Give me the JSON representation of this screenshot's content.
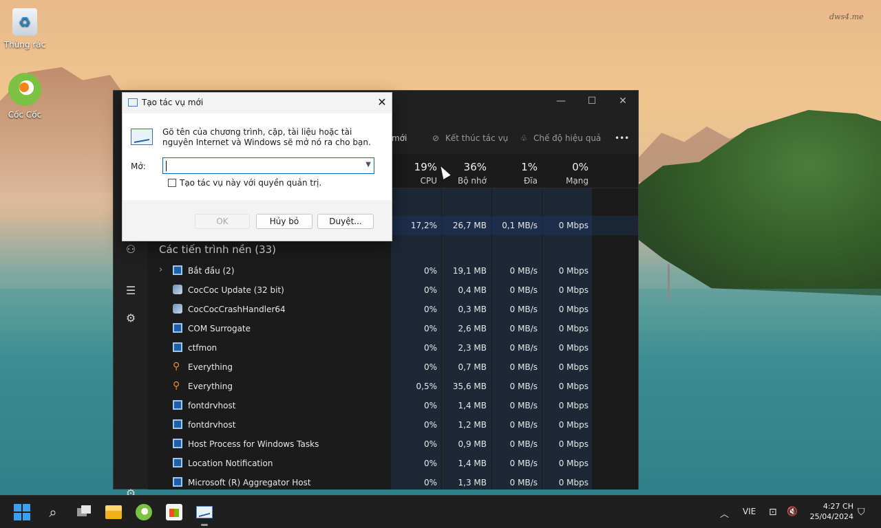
{
  "desktop": {
    "watermark": "dws4.me",
    "icons": [
      {
        "label": "Thùng rác"
      },
      {
        "label": "Cốc Cốc"
      }
    ]
  },
  "task_manager": {
    "window_controls": {
      "minimize": "—",
      "maximize": "☐",
      "close": "✕"
    },
    "toolbar": {
      "run_new_task": "mới",
      "end_task": "Kết thúc tác vụ",
      "efficiency_mode": "Chế độ hiệu quả",
      "more": "•••"
    },
    "headers": {
      "cpu": {
        "pct": "19%",
        "label": "CPU"
      },
      "memory": {
        "pct": "36%",
        "label": "Bộ nhớ"
      },
      "disk": {
        "pct": "1%",
        "label": "Đĩa"
      },
      "network": {
        "pct": "0%",
        "label": "Mạng"
      }
    },
    "app_row": {
      "cpu": "17,2%",
      "memory": "26,7 MB",
      "disk": "0,1 MB/s",
      "network": "0 Mbps"
    },
    "section_title": "Các tiến trình nền (33)",
    "processes": [
      {
        "name": "Bắt đầu (2)",
        "icon": "window-icon",
        "expandable": true,
        "cpu": "0%",
        "memory": "19,1 MB",
        "disk": "0 MB/s",
        "network": "0 Mbps"
      },
      {
        "name": "CocCoc Update (32 bit)",
        "icon": "coccoc-update-icon",
        "cpu": "0%",
        "memory": "0,4 MB",
        "disk": "0 MB/s",
        "network": "0 Mbps"
      },
      {
        "name": "CocCocCrashHandler64",
        "icon": "coccoc-update-icon",
        "cpu": "0%",
        "memory": "0,3 MB",
        "disk": "0 MB/s",
        "network": "0 Mbps"
      },
      {
        "name": "COM Surrogate",
        "icon": "window-icon",
        "cpu": "0%",
        "memory": "2,6 MB",
        "disk": "0 MB/s",
        "network": "0 Mbps"
      },
      {
        "name": "ctfmon",
        "icon": "window-icon",
        "cpu": "0%",
        "memory": "2,3 MB",
        "disk": "0 MB/s",
        "network": "0 Mbps"
      },
      {
        "name": "Everything",
        "icon": "everything-search-icon",
        "cpu": "0%",
        "memory": "0,7 MB",
        "disk": "0 MB/s",
        "network": "0 Mbps"
      },
      {
        "name": "Everything",
        "icon": "everything-search-icon",
        "cpu": "0,5%",
        "memory": "35,6 MB",
        "disk": "0 MB/s",
        "network": "0 Mbps"
      },
      {
        "name": "fontdrvhost",
        "icon": "window-icon",
        "cpu": "0%",
        "memory": "1,4 MB",
        "disk": "0 MB/s",
        "network": "0 Mbps"
      },
      {
        "name": "fontdrvhost",
        "icon": "window-icon",
        "cpu": "0%",
        "memory": "1,2 MB",
        "disk": "0 MB/s",
        "network": "0 Mbps"
      },
      {
        "name": "Host Process for Windows Tasks",
        "icon": "window-icon",
        "cpu": "0%",
        "memory": "0,9 MB",
        "disk": "0 MB/s",
        "network": "0 Mbps"
      },
      {
        "name": "Location Notification",
        "icon": "window-icon",
        "cpu": "0%",
        "memory": "1,4 MB",
        "disk": "0 MB/s",
        "network": "0 Mbps"
      },
      {
        "name": "Microsoft (R) Aggregator Host",
        "icon": "window-icon",
        "cpu": "0%",
        "memory": "1,3 MB",
        "disk": "0 MB/s",
        "network": "0 Mbps"
      }
    ]
  },
  "run_dialog": {
    "title": "Tạo tác vụ mới",
    "description": "Gõ tên của chương trình, cặp, tài liệu hoặc tài nguyên Internet và Windows sẽ mở nó ra cho bạn.",
    "open_label": "Mở:",
    "open_value": "",
    "admin_checkbox_label": "Tạo tác vụ này với quyền quản trị.",
    "buttons": {
      "ok": "OK",
      "cancel": "Hủy bỏ",
      "browse": "Duyệt..."
    }
  },
  "taskbar": {
    "language": "VIE",
    "time": "4:27 CH",
    "date": "25/04/2024"
  },
  "colors": {
    "accent": "#0067c0",
    "tm_bg": "#202020",
    "heat_column": "#1d2736"
  }
}
